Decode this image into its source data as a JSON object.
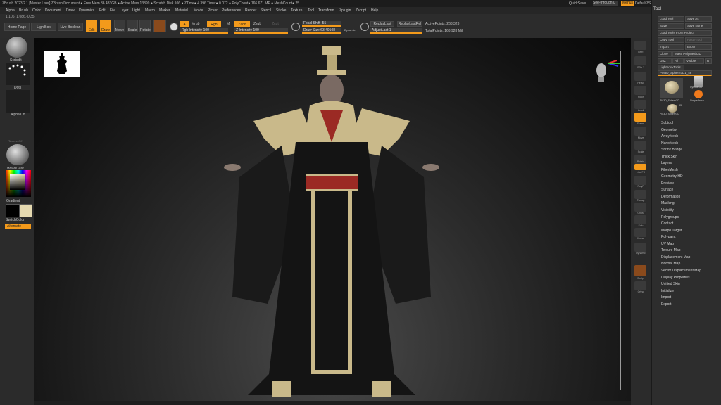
{
  "titlebar": {
    "title": "ZBrush 2023.2.1 [Master User]    ZBrush Document    ● Free Mem 36.433GB ● Active Mem 13899 ● Scratch Disk 106 ● ZTime● 4.396 Timer● 0.072 ● PolyCount● 166.671 MP ● MeshCount● 25",
    "quicksave": "QuickSave",
    "seethrough": "See-through  0",
    "menus": "Menus",
    "script": "DefaultZScript"
  },
  "menubar": [
    "Alpha",
    "Brush",
    "Color",
    "Document",
    "Draw",
    "Dynamics",
    "Edit",
    "File",
    "Layer",
    "Light",
    "Macro",
    "Marker",
    "Material",
    "Movie",
    "Picker",
    "Preferences",
    "Render",
    "Stencil",
    "Stroke",
    "Texture",
    "Tool",
    "Transform",
    "Zplugin",
    "Zscript",
    "Help"
  ],
  "coords": "1.106, 1.086,-0.35",
  "toolbar": {
    "home": "Home Page",
    "lightbox": "LightBox",
    "livebool": "Live Boolean",
    "edit": "Edit",
    "draw": "Draw",
    "move": "Move",
    "scale": "Scale",
    "rotate": "Rotate",
    "a": "A",
    "mrgb": "Mrgb",
    "rgb": "Rgb",
    "m": "M",
    "zadd": "Zadd",
    "zsub": "Zsub",
    "zcut": "Zcut",
    "rgb_intensity": "Rgb Intensity 100",
    "z_intensity": "Z Intensity 100",
    "focal_shift": "Focal Shift -55",
    "draw_size": "Draw Size 63.49108",
    "dynamic": "Dynamic",
    "replay_last": "ReplayLast",
    "replay_last_rel": "ReplayLastRel",
    "adjust_last": "AdjustLast 1",
    "active_points": "ActivePoints: 263,323",
    "total_points": "TotalPoints: 163.928 Mil"
  },
  "leftshelf": {
    "brush_label": "Scrtsdlt",
    "stroke_label": "Dots",
    "alpha_label": "Alpha Off",
    "texture_label": "Texture Off",
    "material_label": "MatCap Gray",
    "gradient": "Gradient",
    "switchcolor": "SwitchColor",
    "alternate": "Alternate"
  },
  "rightshelf": [
    "BPR",
    "SPix 3",
    "Persp",
    "Floor",
    "Local",
    "Frame",
    "Move",
    "Scale",
    "Rotate",
    "Line Fill",
    "PolyF",
    "Transp",
    "Ghost",
    "Solo",
    "Xpose",
    "Dynamic",
    "Sculpt",
    "Ortho"
  ],
  "toolpanel": {
    "title": "Tool",
    "load_tool": "Load Tool",
    "save_as": "Save As",
    "save": "Save",
    "save_none": "Save None",
    "load_from_project": "Load Tools From Project",
    "copy_tool": "Copy Tool",
    "paste_tool": "Paste Tool",
    "import": "Import",
    "export": "Export",
    "clone": "Clone",
    "make_polymesh": "Make PolyMesh3D",
    "goz": "GoZ",
    "all": "All",
    "visible": "Visible",
    "r": "R",
    "lightbox_tools": "Lightbox▸Tools",
    "current_tool": "PM3D_Sphere3D1_48",
    "thumb1": "PM3D_Sphere3C",
    "thumb2": "Cylinder3D",
    "thumb3": "SimpleBrush",
    "thumb4": "PM3D_Sphere3C",
    "thumb_count": "33",
    "subpalettes": [
      "Subtool",
      "Geometry",
      "ArrayMesh",
      "NanoMesh",
      "Shrink Bridge",
      "Thick Skin",
      "Layers",
      "FiberMesh",
      "Geometry HD",
      "Preview",
      "Surface",
      "Deformation",
      "Masking",
      "Visibility",
      "Polygroups",
      "Contact",
      "Morph Target",
      "Polypaint",
      "UV Map",
      "Texture Map",
      "Displacement Map",
      "Normal Map",
      "Vector Displacement Map",
      "Display Properties",
      "Unified Skin",
      "Initialize",
      "Import",
      "Export"
    ]
  },
  "colors": {
    "accent": "#f39a1b",
    "robe": "#1a1a1a",
    "gold": "#c9b98a",
    "sash": "#9b2a24"
  }
}
